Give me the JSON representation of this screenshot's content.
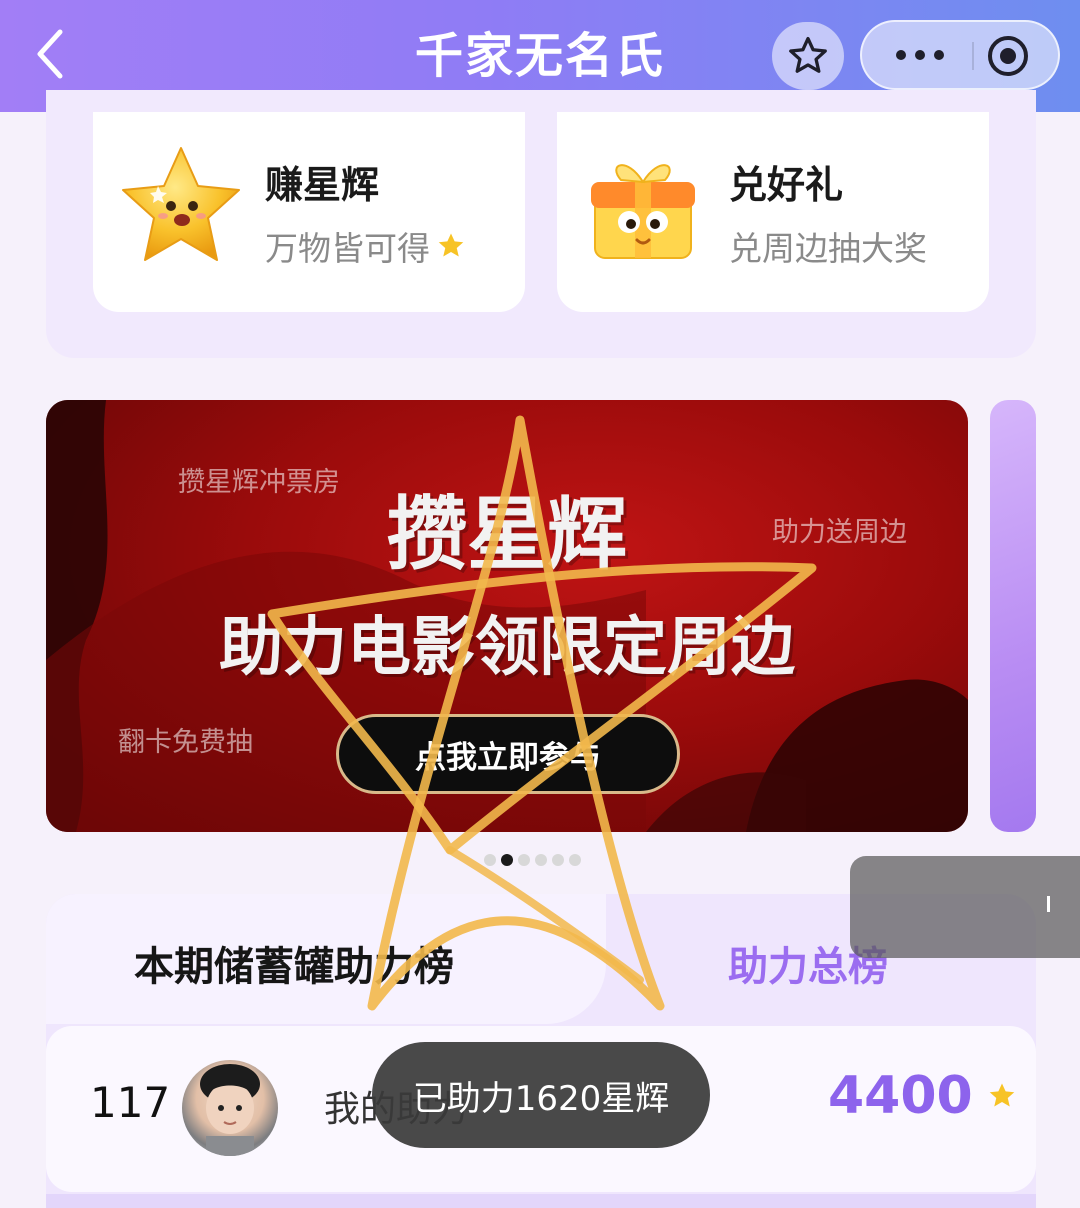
{
  "topbar": {
    "title": "千家无名氏"
  },
  "features": [
    {
      "title": "赚星辉",
      "subtitle": "万物皆可得",
      "icon": "star-mascot-icon"
    },
    {
      "title": "兑好礼",
      "subtitle": "兑周边抽大奖",
      "icon": "gift-box-mascot-icon"
    }
  ],
  "banner": {
    "small_top_left": "攒星辉冲票房",
    "small_right": "助力送周边",
    "small_bottom_left": "翻卡免费抽",
    "headline": "攒星辉",
    "subheadline": "助力电影领限定周边",
    "cta": "点我立即参与",
    "pages": 6,
    "active_page": 2
  },
  "leaderboard": {
    "tab_current": "本期储蓄罐助力榜",
    "tab_total": "助力总榜",
    "my_row": {
      "rank": "117",
      "label": "我的助力",
      "score": "4400"
    }
  },
  "toast": {
    "message": "已助力1620星辉"
  },
  "colors": {
    "accent_purple": "#9b6df0",
    "star_yellow": "#f7c326",
    "overlay_stroke": "#f2b84b"
  }
}
